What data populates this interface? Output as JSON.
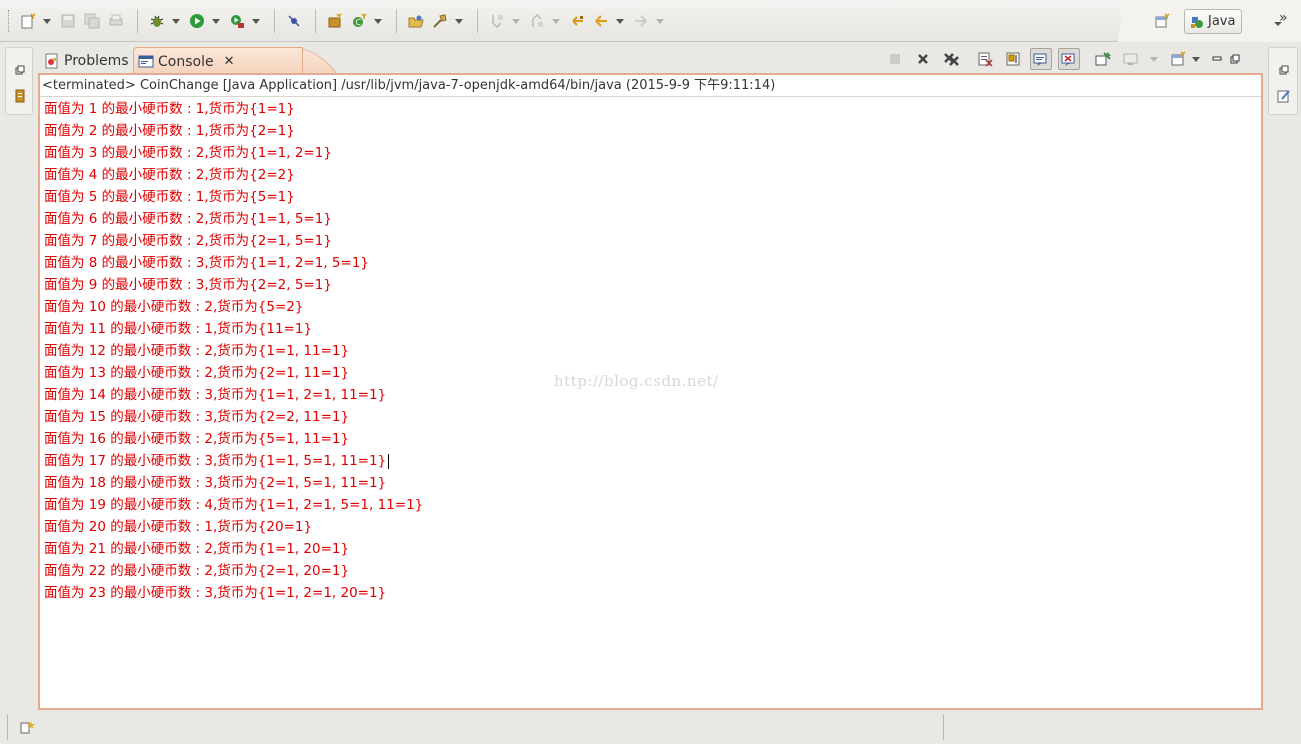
{
  "toolbar": {
    "perspective_label": "Java",
    "icons": [
      "new-icon",
      "save-icon",
      "save-all-icon",
      "print-icon",
      "debug-icon",
      "run-icon",
      "run-external-tool-icon",
      "toggle-breakpoint-icon",
      "new-java-project-icon",
      "new-class-icon",
      "open-type-icon",
      "search-icon",
      "next-annotation-icon",
      "previous-annotation-icon",
      "last-edit-icon",
      "back-icon",
      "forward-icon"
    ]
  },
  "tabs": [
    {
      "label": "Problems"
    },
    {
      "label": "Console"
    }
  ],
  "console": {
    "header": "<terminated> CoinChange [Java Application] /usr/lib/jvm/java-7-openjdk-amd64/bin/java (2015-9-9 下午9:11:14)",
    "lines": [
      "面值为 1 的最小硬币数 : 1,货币为{1=1}",
      "面值为 2 的最小硬币数 : 1,货币为{2=1}",
      "面值为 3 的最小硬币数 : 2,货币为{1=1, 2=1}",
      "面值为 4 的最小硬币数 : 2,货币为{2=2}",
      "面值为 5 的最小硬币数 : 1,货币为{5=1}",
      "面值为 6 的最小硬币数 : 2,货币为{1=1, 5=1}",
      "面值为 7 的最小硬币数 : 2,货币为{2=1, 5=1}",
      "面值为 8 的最小硬币数 : 3,货币为{1=1, 2=1, 5=1}",
      "面值为 9 的最小硬币数 : 3,货币为{2=2, 5=1}",
      "面值为 10 的最小硬币数 : 2,货币为{5=2}",
      "面值为 11 的最小硬币数 : 1,货币为{11=1}",
      "面值为 12 的最小硬币数 : 2,货币为{1=1, 11=1}",
      "面值为 13 的最小硬币数 : 2,货币为{2=1, 11=1}",
      "面值为 14 的最小硬币数 : 3,货币为{1=1, 2=1, 11=1}",
      "面值为 15 的最小硬币数 : 3,货币为{2=2, 11=1}",
      "面值为 16 的最小硬币数 : 2,货币为{5=1, 11=1}",
      "面值为 17 的最小硬币数 : 3,货币为{1=1, 5=1, 11=1}",
      "面值为 18 的最小硬币数 : 3,货币为{2=1, 5=1, 11=1}",
      "面值为 19 的最小硬币数 : 4,货币为{1=1, 2=1, 5=1, 11=1}",
      "面值为 20 的最小硬币数 : 1,货币为{20=1}",
      "面值为 21 的最小硬币数 : 2,货币为{1=1, 20=1}",
      "面值为 22 的最小硬币数 : 2,货币为{2=1, 20=1}",
      "面值为 23 的最小硬币数 : 3,货币为{1=1, 2=1, 20=1}"
    ],
    "output_color": "#e00000",
    "watermark": "http://blog.csdn.net/"
  },
  "colors": {
    "active_tab": "#f5d2bb",
    "frame_border": "#e6aa91",
    "output_text": "#e00000"
  }
}
